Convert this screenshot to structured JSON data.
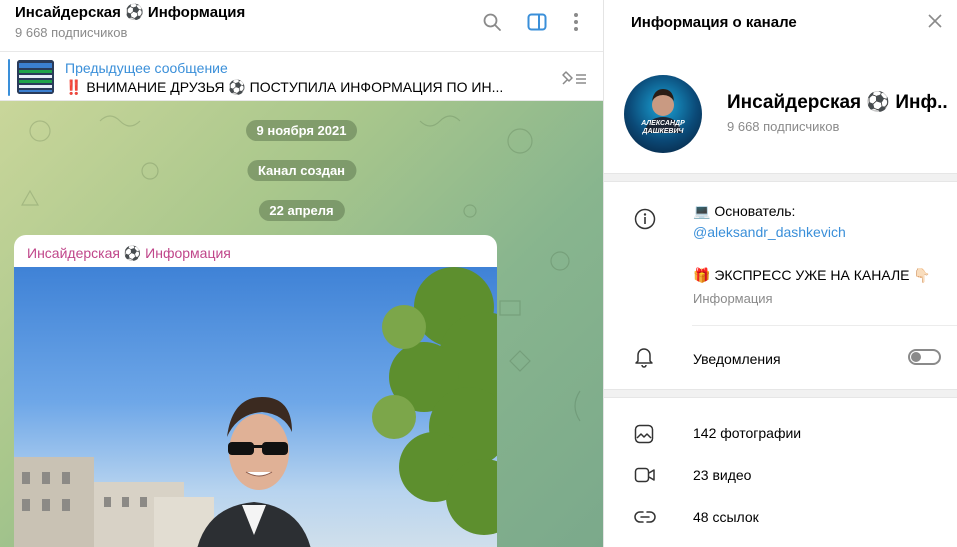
{
  "chat": {
    "title": "Инсайдерская ⚽ Информация",
    "subscribers": "9 668 подписчиков",
    "pinned": {
      "label": "Предыдущее сообщение",
      "text": "‼️ ВНИМАНИЕ ДРУЗЬЯ ⚽ ПОСТУПИЛА ИНФОРМАЦИЯ ПО ИН..."
    },
    "dates": [
      "9 ноября 2021",
      "Канал создан",
      "22 апреля"
    ],
    "message": {
      "author": "Инсайдерская ⚽ Информация"
    },
    "icons": [
      "search-icon",
      "sidebar-toggle-icon",
      "more-vertical-icon",
      "pin-list-icon"
    ]
  },
  "panel": {
    "title": "Информация о канале",
    "channel_name": "Инсайдерская ⚽ Инф...",
    "channel_subs": "9 668 подписчиков",
    "avatar_text": "АЛЕКСАНДР ДАШКЕВИЧ",
    "description": {
      "line1": "💻 Основатель:",
      "link": "@aleksandr_dashkevich",
      "line3": "🎁 ЭКСПРЕСС УЖЕ НА КАНАЛЕ 👇🏻",
      "caption": "Информация"
    },
    "notifications": {
      "label": "Уведомления",
      "enabled": false
    },
    "media": [
      {
        "icon": "photo-icon",
        "label": "142 фотографии"
      },
      {
        "icon": "video-icon",
        "label": "23 видео"
      },
      {
        "icon": "link-icon",
        "label": "48 ссылок"
      }
    ]
  },
  "colors": {
    "accent": "#3a8fd9",
    "author": "#c0468a",
    "muted": "#8a8a8a"
  }
}
